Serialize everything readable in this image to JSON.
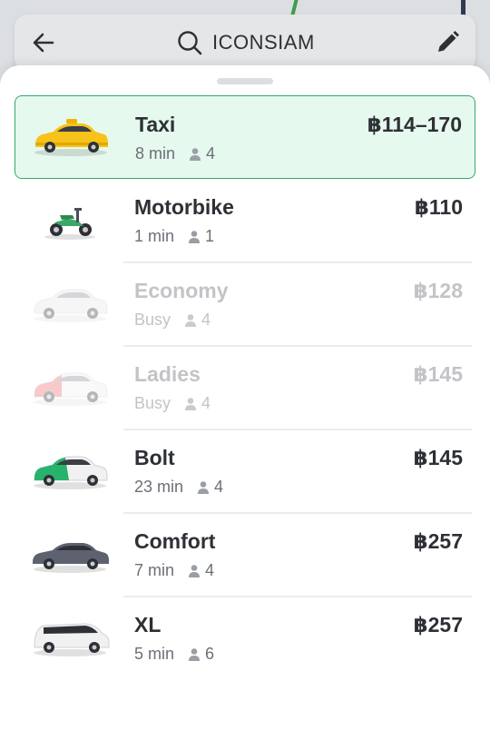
{
  "search": {
    "value": "ICONSIAM"
  },
  "colors": {
    "selected_bg": "#e6f9ee",
    "selected_border": "#35a96b",
    "text": "#2d3035",
    "muted": "#6b7078",
    "busy": "#c2c4c7"
  },
  "rides": [
    {
      "name": "Taxi",
      "eta": "8 min",
      "seats": "4",
      "price": "฿114–170",
      "icon": "taxi-car-icon",
      "car_color": "#f7c21a"
    },
    {
      "name": "Motorbike",
      "eta": "1 min",
      "seats": "1",
      "price": "฿110",
      "icon": "motorbike-icon",
      "car_color": "#3aa868"
    },
    {
      "name": "Economy",
      "eta": "Busy",
      "seats": "4",
      "price": "฿128",
      "icon": "economy-car-icon",
      "car_color": "#f3f3f3"
    },
    {
      "name": "Ladies",
      "eta": "Busy",
      "seats": "4",
      "price": "฿145",
      "icon": "ladies-car-icon",
      "car_color": "#f06b6b"
    },
    {
      "name": "Bolt",
      "eta": "23 min",
      "seats": "4",
      "price": "฿145",
      "icon": "bolt-car-icon",
      "car_color": "#27b36b"
    },
    {
      "name": "Comfort",
      "eta": "7 min",
      "seats": "4",
      "price": "฿257",
      "icon": "comfort-car-icon",
      "car_color": "#5e6270"
    },
    {
      "name": "XL",
      "eta": "5 min",
      "seats": "6",
      "price": "฿257",
      "icon": "xl-van-icon",
      "car_color": "#f1f1f1"
    }
  ]
}
